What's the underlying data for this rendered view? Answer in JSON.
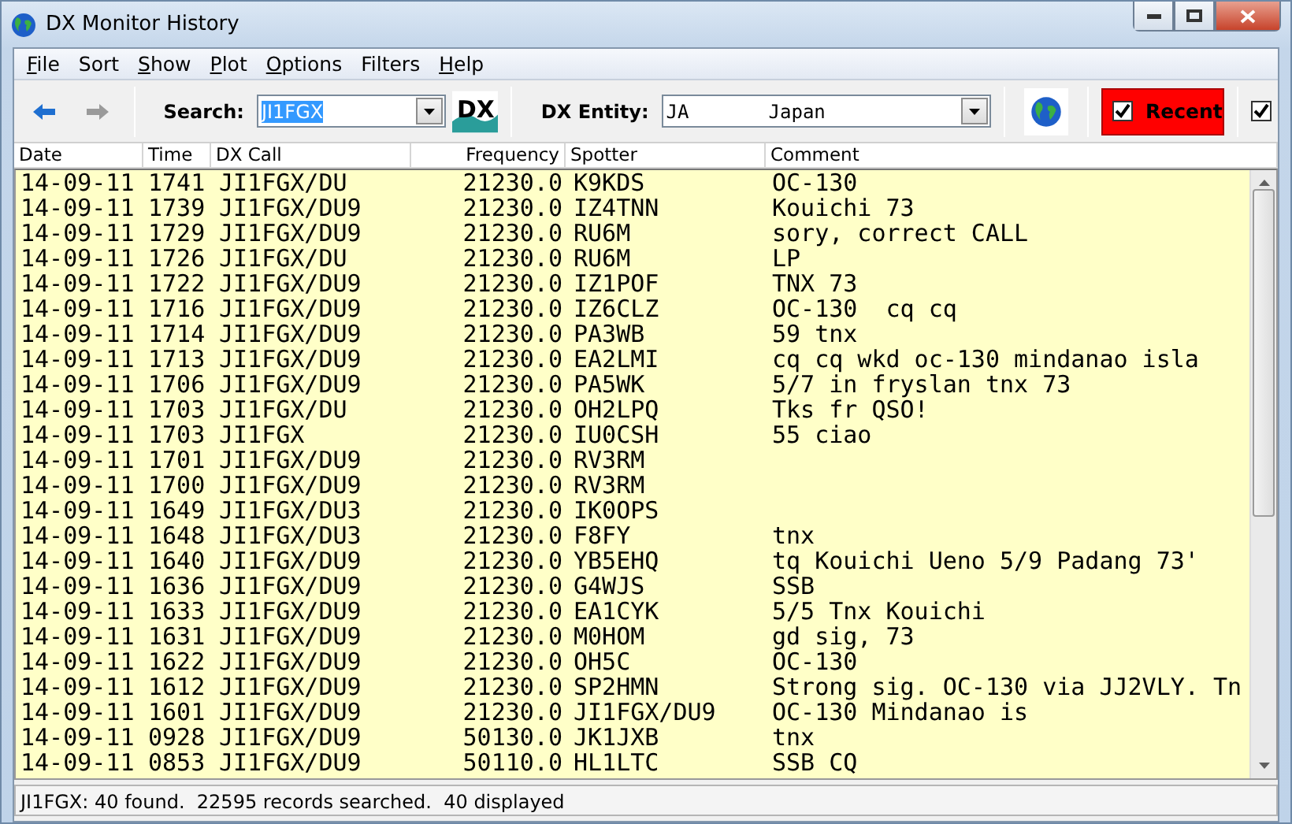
{
  "window": {
    "title": "DX Monitor History"
  },
  "menu": [
    {
      "label": "File",
      "first_letter_underlined": true
    },
    {
      "label": "Sort",
      "first_letter_underlined": false
    },
    {
      "label": "Show",
      "first_letter_underlined": true
    },
    {
      "label": "Plot",
      "first_letter_underlined": true
    },
    {
      "label": "Options",
      "first_letter_underlined": true
    },
    {
      "label": "Filters",
      "first_letter_underlined": false
    },
    {
      "label": "Help",
      "first_letter_underlined": true
    }
  ],
  "toolbar": {
    "nav": [
      {
        "kind": "back",
        "disabled": false
      },
      {
        "kind": "forward",
        "disabled": true
      }
    ],
    "search": {
      "label": "Search:",
      "value": "JI1FGX",
      "selected": true
    },
    "logo_text": "DX",
    "entity": {
      "label": "DX Entity:",
      "value": "JA       Japan"
    },
    "recent": {
      "label": "Recent",
      "checked": true
    },
    "extra_checkbox": {
      "checked": true
    }
  },
  "table": {
    "columns": [
      {
        "label": "Date"
      },
      {
        "label": "Time"
      },
      {
        "label": "DX Call"
      },
      {
        "label": "Frequency"
      },
      {
        "label": "Spotter"
      },
      {
        "label": "Comment"
      }
    ],
    "rows": [
      {
        "date": "14-09-11",
        "time": "1741",
        "dx_call": "JI1FGX/DU",
        "frequency": "21230.0",
        "spotter": "K9KDS",
        "comment": "OC-130"
      },
      {
        "date": "14-09-11",
        "time": "1739",
        "dx_call": "JI1FGX/DU9",
        "frequency": "21230.0",
        "spotter": "IZ4TNN",
        "comment": "Kouichi 73"
      },
      {
        "date": "14-09-11",
        "time": "1729",
        "dx_call": "JI1FGX/DU9",
        "frequency": "21230.0",
        "spotter": "RU6M",
        "comment": "sory, correct CALL"
      },
      {
        "date": "14-09-11",
        "time": "1726",
        "dx_call": "JI1FGX/DU",
        "frequency": "21230.0",
        "spotter": "RU6M",
        "comment": "LP"
      },
      {
        "date": "14-09-11",
        "time": "1722",
        "dx_call": "JI1FGX/DU9",
        "frequency": "21230.0",
        "spotter": "IZ1POF",
        "comment": "TNX 73"
      },
      {
        "date": "14-09-11",
        "time": "1716",
        "dx_call": "JI1FGX/DU9",
        "frequency": "21230.0",
        "spotter": "IZ6CLZ",
        "comment": "OC-130  cq cq"
      },
      {
        "date": "14-09-11",
        "time": "1714",
        "dx_call": "JI1FGX/DU9",
        "frequency": "21230.0",
        "spotter": "PA3WB",
        "comment": "59 tnx"
      },
      {
        "date": "14-09-11",
        "time": "1713",
        "dx_call": "JI1FGX/DU9",
        "frequency": "21230.0",
        "spotter": "EA2LMI",
        "comment": "cq cq wkd oc-130 mindanao isla"
      },
      {
        "date": "14-09-11",
        "time": "1706",
        "dx_call": "JI1FGX/DU9",
        "frequency": "21230.0",
        "spotter": "PA5WK",
        "comment": "5/7 in fryslan tnx 73"
      },
      {
        "date": "14-09-11",
        "time": "1703",
        "dx_call": "JI1FGX/DU",
        "frequency": "21230.0",
        "spotter": "OH2LPQ",
        "comment": "Tks fr QSO!"
      },
      {
        "date": "14-09-11",
        "time": "1703",
        "dx_call": "JI1FGX",
        "frequency": "21230.0",
        "spotter": "IU0CSH",
        "comment": "55 ciao"
      },
      {
        "date": "14-09-11",
        "time": "1701",
        "dx_call": "JI1FGX/DU9",
        "frequency": "21230.0",
        "spotter": "RV3RM"
      },
      {
        "date": "14-09-11",
        "time": "1700",
        "dx_call": "JI1FGX/DU9",
        "frequency": "21230.0",
        "spotter": "RV3RM"
      },
      {
        "date": "14-09-11",
        "time": "1649",
        "dx_call": "JI1FGX/DU3",
        "frequency": "21230.0",
        "spotter": "IK0OPS"
      },
      {
        "date": "14-09-11",
        "time": "1648",
        "dx_call": "JI1FGX/DU3",
        "frequency": "21230.0",
        "spotter": "F8FY",
        "comment": "tnx"
      },
      {
        "date": "14-09-11",
        "time": "1640",
        "dx_call": "JI1FGX/DU9",
        "frequency": "21230.0",
        "spotter": "YB5EHQ",
        "comment": "tq Kouichi Ueno 5/9 Padang 73'"
      },
      {
        "date": "14-09-11",
        "time": "1636",
        "dx_call": "JI1FGX/DU9",
        "frequency": "21230.0",
        "spotter": "G4WJS",
        "comment": "SSB"
      },
      {
        "date": "14-09-11",
        "time": "1633",
        "dx_call": "JI1FGX/DU9",
        "frequency": "21230.0",
        "spotter": "EA1CYK",
        "comment": "5/5 Tnx Kouichi"
      },
      {
        "date": "14-09-11",
        "time": "1631",
        "dx_call": "JI1FGX/DU9",
        "frequency": "21230.0",
        "spotter": "M0HOM",
        "comment": "gd sig, 73"
      },
      {
        "date": "14-09-11",
        "time": "1622",
        "dx_call": "JI1FGX/DU9",
        "frequency": "21230.0",
        "spotter": "OH5C",
        "comment": "OC-130"
      },
      {
        "date": "14-09-11",
        "time": "1612",
        "dx_call": "JI1FGX/DU9",
        "frequency": "21230.0",
        "spotter": "SP2HMN",
        "comment": "Strong sig. OC-130 via JJ2VLY. Tn"
      },
      {
        "date": "14-09-11",
        "time": "1601",
        "dx_call": "JI1FGX/DU9",
        "frequency": "21230.0",
        "spotter": "JI1FGX/DU9",
        "comment": "OC-130 Mindanao is"
      },
      {
        "date": "14-09-11",
        "time": "0928",
        "dx_call": "JI1FGX/DU9",
        "frequency": "50130.0",
        "spotter": "JK1JXB",
        "comment": "tnx"
      },
      {
        "date": "14-09-11",
        "time": "0853",
        "dx_call": "JI1FGX/DU9",
        "frequency": "50110.0",
        "spotter": "HL1LTC",
        "comment": "SSB CQ"
      }
    ]
  },
  "status_bar": "JI1FGX: 40 found.  22595 records searched.  40 displayed"
}
